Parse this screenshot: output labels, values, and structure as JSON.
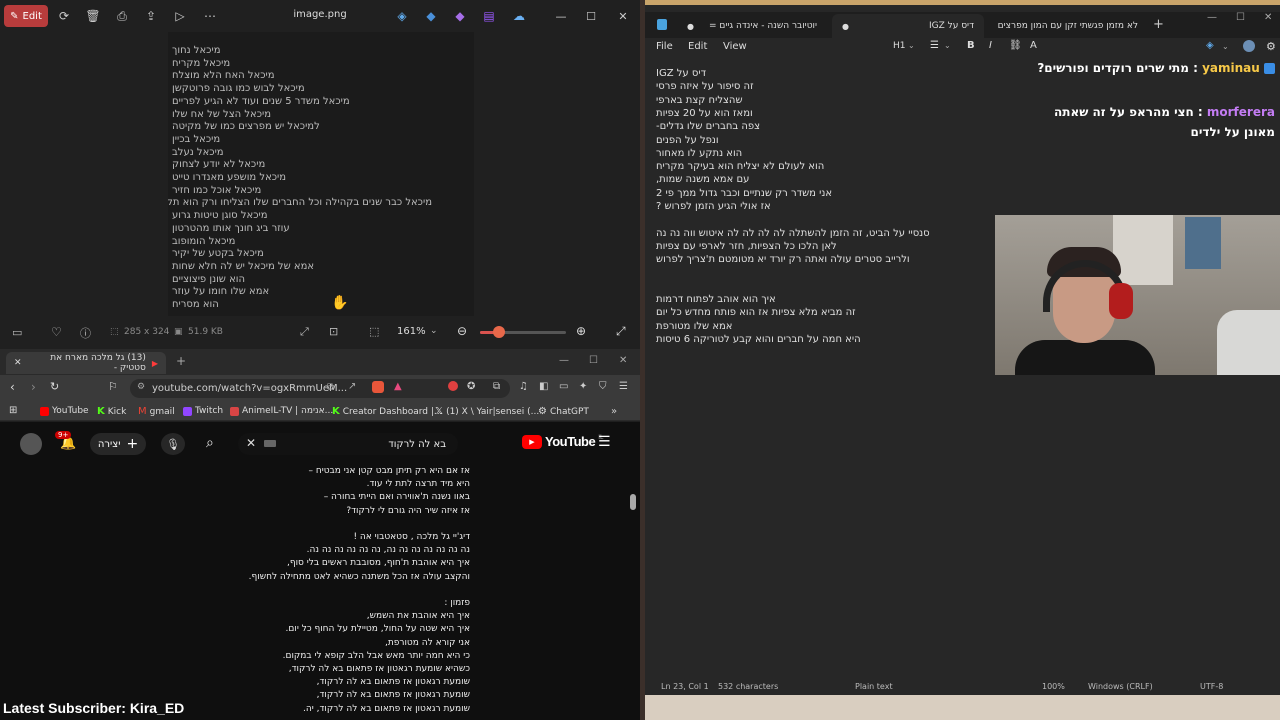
{
  "viewer": {
    "edit_label": "Edit",
    "file_title": "image.png",
    "image_lines": [
      "מיכאל נחוך",
      "מיכאל מקריח",
      "מיכאל האח הלא מוצלח",
      "מיכאל לבוש כמו גובה פרוטקשן",
      "מיכאל משדר 5 שנים ועוד לא הגיע לפריים",
      "מיכאל הצל של אח שלו",
      "למיכאל יש מפרצים כמו של מקיטה",
      "מיכאל בכיין",
      "מיכאל נעלב",
      "מיכאל לא יודע לצחוק",
      "מיכאל מושפע מאנדרו טייט",
      "מיכאל אוכל כמו חזיר",
      "מיכאל כבר שנים בקהילה וכל החברים שלו הצליחו ורק הוא תקוע",
      "מיכאל סוגן טיטות גרוע",
      "עוזר ביג חונך אותו מהטרטון",
      "מיכאל הומופוב",
      "מיכאל בקטע של יקיר",
      "אמא של מיכאל יש לה חלא שחות",
      "הוא שונן פיצוציים",
      "אמא שלו חומו על עוזר",
      "הוא מסריח"
    ],
    "dimensions": "285 x 324",
    "filesize": "51.9 KB",
    "zoom": "161%",
    "zoom_fraction": 0.22
  },
  "browser": {
    "tab_title": "(13) גל מלכה מארח את סטטיק -",
    "url": "youtube.com/watch?v=ogxRmmUeM...",
    "bookmarks": [
      "YouTube",
      "Kick",
      "gmail",
      "Twitch",
      "AnimeIL-TV | אנימה...",
      "Creator Dashboard |...",
      "(1) X \\ Yair|sensei (...",
      "ChatGPT"
    ],
    "yt_logo": "YouTube",
    "yt_country": "IL",
    "search_value": "בא לה לרקוד",
    "create_label": "יצירה",
    "notif_badge": "9+",
    "lyrics": [
      "אז אם היא רק תיתן מבט קטן אני מבטיח –",
      "היא מיד תרצה לתת לי עוד.",
      "באוו נשנה ת'אווירה  ואם הייתי בחורה –",
      "אז איזה שיר היה גורם לי לרקוד?",
      "",
      "דיג'יי גל מלכה , סטאטבוי אה !",
      "נה נה נה נה נה נה נה, נה נה נה נה נה נה.",
      "איך היא אוהבת ת'חוף, מסובבת ראשים בלי סוף,",
      "והקצב עולה אז הכל משתנה כשהיא לאט מתחילה לחשוף.",
      "",
      "פזמון :",
      "איך היא אוהבת את השמש,",
      "איך היא שטה על החול, מטיילת על החוף כל יום.",
      "אני קורא לה מטורפת,",
      "כי היא חמה יותר מאש אבל הלב קופא לי במקום.",
      "כשהיא שומעת רגאטון אז פתאום בא לה לרקוד,",
      "שומעת רגאטון אז פתאום בא לה לרקוד,",
      "שומעת רגאטון אז פתאום בא לה לרקוד,",
      "שומעת רגאטון אז פתאום בא לה לרקוד, יה."
    ]
  },
  "overlay": {
    "latest_subscriber": "Latest Subscriber: Kira_ED"
  },
  "notepad": {
    "tabs": [
      "לא מזמן פגשתי זקן עם המון מפרצים",
      "דיס על IGZ",
      "יוטיובר השנה - אינדה גיים ="
    ],
    "menu": [
      "File",
      "Edit",
      "View"
    ],
    "heading_label": "H1",
    "lines": [
      "דיס על IGZ",
      "זה סיפור על איזה פרסי",
      "שהצליח קצת בארפי",
      "ומאז הוא על 20 צפיות",
      "צפה בחברים שלו גדלים-",
      "ונפל על הפנים",
      "הוא נתקע לו מאחור",
      "הוא לעולם לא יצליח הוא בעיקר מקריח",
      "עם אמא משנה שמות,",
      "אני משדר רק שנתיים וכבר גדול ממך פי 2",
      "אז אולי הגיע הזמן לפרוש ?",
      "",
      "סנסיי על הביט, זה הזמן להשתלה לה לה לה לה איטוש ווה נה נה",
      "לאן הלכו כל הצפיות, חזר לארפי עם צפיות",
      "ולרייב סטרים עולה ואתה רק יורד יא מטומטם ת'צריך לפרוש",
      "",
      "",
      "איך הוא אוהב לפתוח דרמות",
      "זה מביא מלא צפיות אז הוא פותח מחדש כל יום",
      "אמא שלו מטורפת",
      "היא חמה על חברים והוא קבע לטוריקה 6 טיסות"
    ],
    "status": {
      "position": "Ln 23, Col 1",
      "characters": "532 characters",
      "mode": "Plain text",
      "zoom": "100%",
      "line_endings": "Windows (CRLF)",
      "encoding": "UTF-8"
    }
  },
  "chat": {
    "messages": [
      {
        "name": "yaminau",
        "text": "מתי שרים רוקדים ופורשים?"
      },
      {
        "name": "morferera",
        "text": "חצי מהראפ על זה שאתה מאונן על ילדים"
      }
    ]
  },
  "colors": {
    "edit_button": "#b83c3c",
    "zoom_accent": "#e8684a",
    "youtube_red": "#ff0000",
    "chat_yaminau": "#f7c948",
    "chat_morferera": "#c37cf3"
  }
}
